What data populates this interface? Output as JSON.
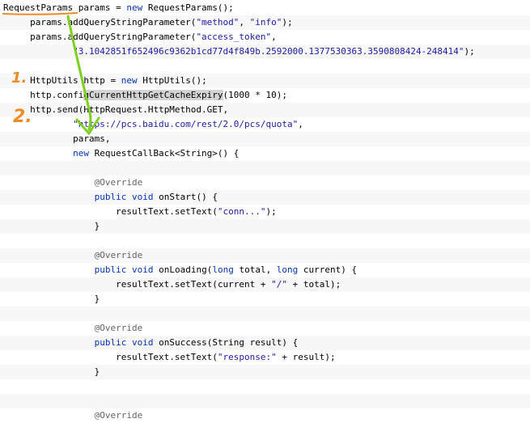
{
  "lines": [
    {
      "indent": "",
      "parts": [
        {
          "text": "RequestParams",
          "cls": "t",
          "name": "class-name"
        },
        {
          "text": " params = ",
          "cls": "t"
        },
        {
          "text": "new",
          "cls": "kw"
        },
        {
          "text": " RequestParams();",
          "cls": "t"
        }
      ]
    },
    {
      "indent": "     ",
      "parts": [
        {
          "text": "params.addQueryStringParameter(",
          "cls": "t"
        },
        {
          "text": "\"method\"",
          "cls": "str"
        },
        {
          "text": ", ",
          "cls": "t"
        },
        {
          "text": "\"info\"",
          "cls": "str"
        },
        {
          "text": ");",
          "cls": "t"
        }
      ]
    },
    {
      "indent": "     ",
      "parts": [
        {
          "text": "params.addQueryStringParameter(",
          "cls": "t"
        },
        {
          "text": "\"access_token\"",
          "cls": "str"
        },
        {
          "text": ",",
          "cls": "t"
        }
      ]
    },
    {
      "indent": "             ",
      "parts": [
        {
          "text": "\"3.1042851f652496c9362b1cd77d4f849b.2592000.1377530363.3590808424-248414\"",
          "cls": "str"
        },
        {
          "text": ");",
          "cls": "t"
        }
      ]
    },
    {
      "indent": "",
      "parts": []
    },
    {
      "indent": "     ",
      "parts": [
        {
          "text": "HttpUtils http = ",
          "cls": "t"
        },
        {
          "text": "new",
          "cls": "kw"
        },
        {
          "text": " HttpUtils();",
          "cls": "t"
        }
      ]
    },
    {
      "indent": "     ",
      "parts": [
        {
          "text": "http.confi",
          "cls": "t"
        },
        {
          "text": "gCurrentHttpGetCacheExpiry",
          "cls": "hl"
        },
        {
          "text": "(1000 * 10);",
          "cls": "t"
        }
      ]
    },
    {
      "indent": "     ",
      "parts": [
        {
          "text": "http.send(HttpRequest.HttpMethod.GET,",
          "cls": "t"
        }
      ]
    },
    {
      "indent": "             ",
      "parts": [
        {
          "text": "\"https://pcs.baidu.com/rest/2.0/pcs/quota\"",
          "cls": "str"
        },
        {
          "text": ",",
          "cls": "t"
        }
      ]
    },
    {
      "indent": "             ",
      "parts": [
        {
          "text": "params,",
          "cls": "t"
        }
      ]
    },
    {
      "indent": "             ",
      "parts": [
        {
          "text": "new",
          "cls": "kw"
        },
        {
          "text": " RequestCallBack<String>() {",
          "cls": "t"
        }
      ]
    },
    {
      "indent": "",
      "parts": []
    },
    {
      "indent": "                 ",
      "parts": [
        {
          "text": "@Override",
          "cls": "ann"
        }
      ]
    },
    {
      "indent": "                 ",
      "parts": [
        {
          "text": "public",
          "cls": "kw"
        },
        {
          "text": " ",
          "cls": "t"
        },
        {
          "text": "void",
          "cls": "kw"
        },
        {
          "text": " onStart() {",
          "cls": "t"
        }
      ]
    },
    {
      "indent": "                     ",
      "parts": [
        {
          "text": "resultText.setText(",
          "cls": "t"
        },
        {
          "text": "\"conn...\"",
          "cls": "str"
        },
        {
          "text": ");",
          "cls": "t"
        }
      ]
    },
    {
      "indent": "                 ",
      "parts": [
        {
          "text": "}",
          "cls": "t"
        }
      ]
    },
    {
      "indent": "",
      "parts": []
    },
    {
      "indent": "                 ",
      "parts": [
        {
          "text": "@Override",
          "cls": "ann"
        }
      ]
    },
    {
      "indent": "                 ",
      "parts": [
        {
          "text": "public",
          "cls": "kw"
        },
        {
          "text": " ",
          "cls": "t"
        },
        {
          "text": "void",
          "cls": "kw"
        },
        {
          "text": " onLoading(",
          "cls": "t"
        },
        {
          "text": "long",
          "cls": "kw"
        },
        {
          "text": " total, ",
          "cls": "t"
        },
        {
          "text": "long",
          "cls": "kw"
        },
        {
          "text": " current) {",
          "cls": "t"
        }
      ]
    },
    {
      "indent": "                     ",
      "parts": [
        {
          "text": "resultText.setText(current + ",
          "cls": "t"
        },
        {
          "text": "\"/\"",
          "cls": "str"
        },
        {
          "text": " + total);",
          "cls": "t"
        }
      ]
    },
    {
      "indent": "                 ",
      "parts": [
        {
          "text": "}",
          "cls": "t"
        }
      ]
    },
    {
      "indent": "",
      "parts": []
    },
    {
      "indent": "                 ",
      "parts": [
        {
          "text": "@Override",
          "cls": "ann"
        }
      ]
    },
    {
      "indent": "                 ",
      "parts": [
        {
          "text": "public",
          "cls": "kw"
        },
        {
          "text": " ",
          "cls": "t"
        },
        {
          "text": "void",
          "cls": "kw"
        },
        {
          "text": " onSuccess(String result) {",
          "cls": "t"
        }
      ]
    },
    {
      "indent": "                     ",
      "parts": [
        {
          "text": "resultText.setText(",
          "cls": "t"
        },
        {
          "text": "\"response:\"",
          "cls": "str"
        },
        {
          "text": " + result);",
          "cls": "t"
        }
      ]
    },
    {
      "indent": "                 ",
      "parts": [
        {
          "text": "}",
          "cls": "t"
        }
      ]
    },
    {
      "indent": "",
      "parts": []
    },
    {
      "indent": "",
      "parts": []
    },
    {
      "indent": "                 ",
      "parts": [
        {
          "text": "@Override",
          "cls": "ann"
        }
      ]
    }
  ],
  "markers": {
    "first": "1.",
    "second": "2."
  },
  "colors": {
    "keyword": "#0033b3",
    "string": "#1a1aa6",
    "annotation_marker": "#f08a24",
    "arrow": "#7fd01e",
    "underline": "#f08a24"
  }
}
